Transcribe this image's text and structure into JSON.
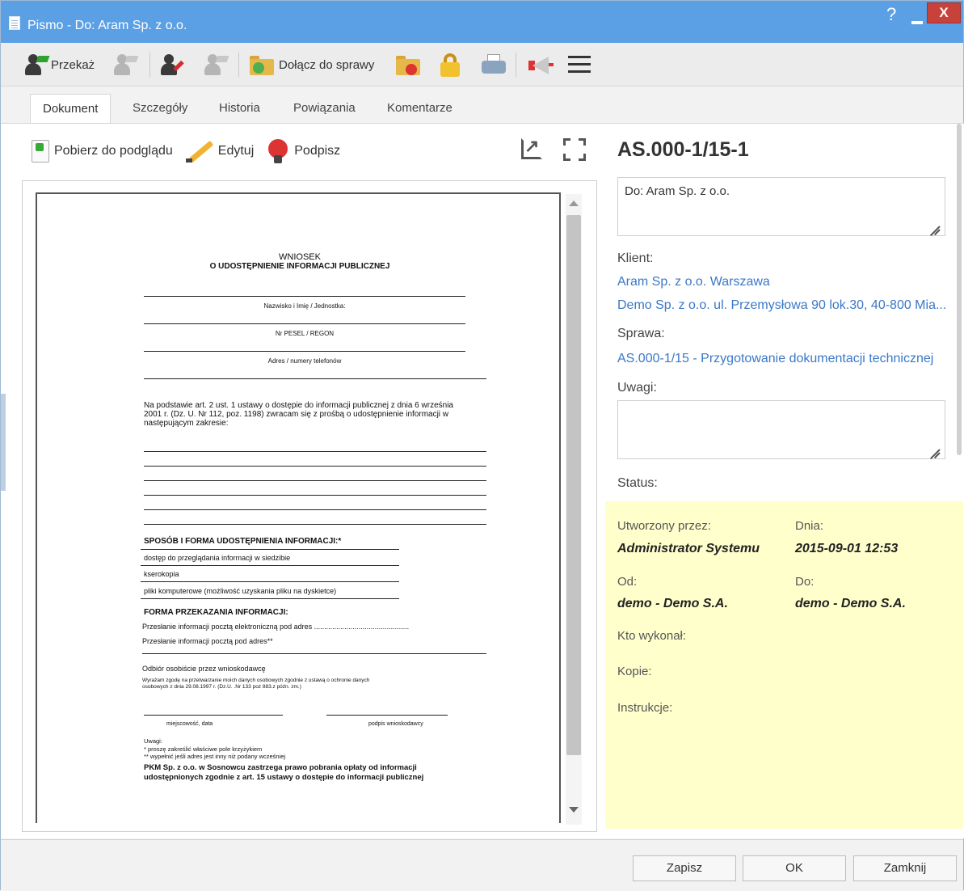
{
  "window": {
    "title": "Pismo - Do: Aram Sp. z o.o.",
    "help": "?",
    "close": "X"
  },
  "toolbar": {
    "forward_label": "Przekaż",
    "attach_label": "Dołącz do sprawy"
  },
  "tabs": [
    "Dokument",
    "Szczegóły",
    "Historia",
    "Powiązania",
    "Komentarze"
  ],
  "doc_tools": {
    "download_label": "Pobierz do podglądu",
    "edit_label": "Edytuj",
    "sign_label": "Podpisz"
  },
  "page": {
    "title": "WNIOSEK",
    "subtitle": "O UDOSTĘPNIENIE INFORMACJI PUBLICZNEJ",
    "field_name": "Nazwisko i Imię / Jednostka:",
    "field_pesel": "Nr PESEL / REGON",
    "field_address": "Adres / numery telefonów",
    "intro_1": "Na podstawie art. 2 ust. 1 ustawy o dostępie do informacji publicznej z dnia 6 września",
    "intro_2": "2001 r. (Dz. U. Nr 112, poz. 1198) zwracam się z prośbą o udostępnienie informacji w",
    "intro_3": "następującym zakresie:",
    "section_1": "SPOSÓB I FORMA UDOSTĘPNIENIA INFORMACJI:*",
    "opt_1": "dostęp do przeglądania informacji w siedzibie",
    "opt_2": "kserokopia",
    "opt_3": "pliki komputerowe (możliwość uzyskania pliku na dyskietce)",
    "section_2": "FORMA PRZEKAZANIA INFORMACJI:",
    "send_1": "Przesłanie informacji pocztą elektroniczną pod adres ...............................................",
    "send_2": "Przesłanie informacji pocztą pod adres**",
    "pickup": "Odbiór osobiście przez wnioskodawcę",
    "consent_1": "Wyrażam zgodę na przetwarzanie moich danych osobowych zgodnie z ustawą o ochronie danych",
    "consent_2": "osobowych z dnia 29.08.1997 r. (Dz.U. .Nr 133 poz 883.z późn. zm.)",
    "place_date": "miejscowość, data",
    "signature": "podpis wnioskodawcy",
    "notes_title": "Uwagi:",
    "note_1": "* proszę zakreślić właściwe pole krzyżykiem",
    "note_2": "** wypełnić jeśli adres jest inny niż podany wcześniej",
    "fee_1": "PKM Sp. z o.o. w Sosnowcu zastrzega prawo pobrania opłaty od informacji",
    "fee_2": "udostępnionych zgodnie z art. 15 ustawy o dostępie do informacji publicznej"
  },
  "details": {
    "reference": "AS.000-1/15-1",
    "recipient_text": "Do: Aram Sp. z o.o.",
    "client_label": "Klient:",
    "clients": [
      "Aram Sp. z o.o. Warszawa",
      "Demo Sp. z o.o. ul. Przemysłowa 90 lok.30, 40-800 Mia..."
    ],
    "case_label": "Sprawa:",
    "case_link": "AS.000-1/15 - Przygotowanie dokumentacji technicznej",
    "notes_label": "Uwagi:",
    "notes_value": "",
    "status_label": "Status:"
  },
  "status_panel": {
    "created_by_label": "Utworzony przez:",
    "created_by": "Administrator Systemu",
    "date_label": "Dnia:",
    "date": "2015-09-01 12:53",
    "from_label": "Od:",
    "from": "demo - Demo S.A.",
    "to_label": "Do:",
    "to": "demo - Demo S.A.",
    "executed_label": "Kto wykonał:",
    "copies_label": "Kopie:",
    "instructions_label": "Instrukcje:"
  },
  "footer": {
    "save": "Zapisz",
    "ok": "OK",
    "close": "Zamknij"
  },
  "colors": {
    "titlebar": "#5ba0e4",
    "close": "#c9423a",
    "link": "#3a78c7",
    "status_bg": "#ffffcc"
  }
}
